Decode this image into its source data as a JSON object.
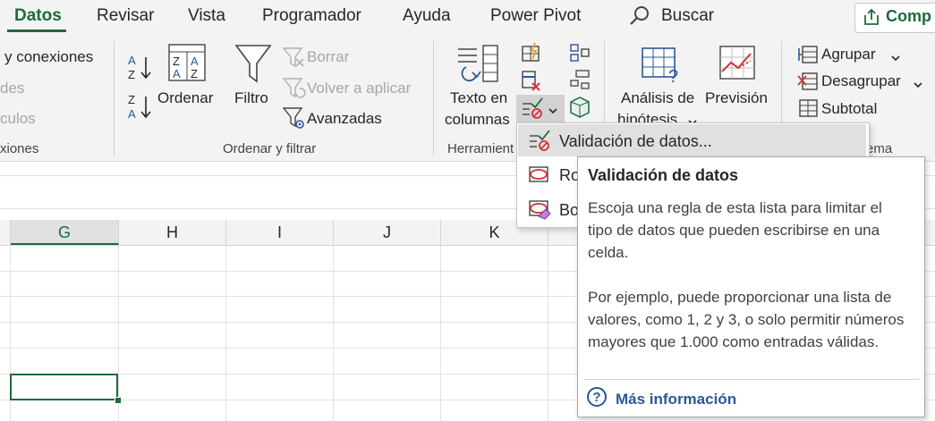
{
  "tabs": [
    {
      "label": "Datos",
      "active": true
    },
    {
      "label": "Revisar"
    },
    {
      "label": "Vista"
    },
    {
      "label": "Programador"
    },
    {
      "label": "Ayuda"
    },
    {
      "label": "Power Pivot"
    }
  ],
  "search": {
    "label": "Buscar"
  },
  "share": {
    "label": "Comp"
  },
  "ribbon": {
    "queries": {
      "item1": "y conexiones",
      "item2": "des",
      "item3": "culos",
      "group_label": "xiones"
    },
    "sort_filter": {
      "sort_label": "Ordenar",
      "filter_label": "Filtro",
      "clear_label": "Borrar",
      "reapply_label": "Volver a aplicar",
      "advanced_label": "Avanzadas",
      "group_label": "Ordenar y filtrar"
    },
    "data_tools": {
      "text_to_columns_line1": "Texto en",
      "text_to_columns_line2": "columnas",
      "group_label": "Herramient"
    },
    "forecast": {
      "whatif_line1": "Análisis de",
      "whatif_line2": "hipótesis",
      "forecast_label": "Previsión"
    },
    "outline": {
      "group_label": "Agrupar",
      "ungroup_label": "Desagrupar",
      "subtotal_label": "Subtotal",
      "section_label": "ema"
    }
  },
  "columns": [
    "G",
    "H",
    "I",
    "J",
    "K"
  ],
  "menu": {
    "items": [
      {
        "label": "Validación de datos..."
      },
      {
        "label": "Ro"
      },
      {
        "label": "Bo"
      }
    ]
  },
  "tooltip": {
    "title": "Validación de datos",
    "body": "Escoja una regla de esta lista para limitar el tipo de datos que pueden escribirse en una celda.\n\nPor ejemplo, puede proporcionar una lista de valores, como 1, 2 y 3, o solo permitir números mayores que 1.000 como entradas válidas.",
    "link": "Más información"
  },
  "colors": {
    "accent": "#1d6b3b",
    "link": "#2b579a",
    "error": "#d13438"
  }
}
